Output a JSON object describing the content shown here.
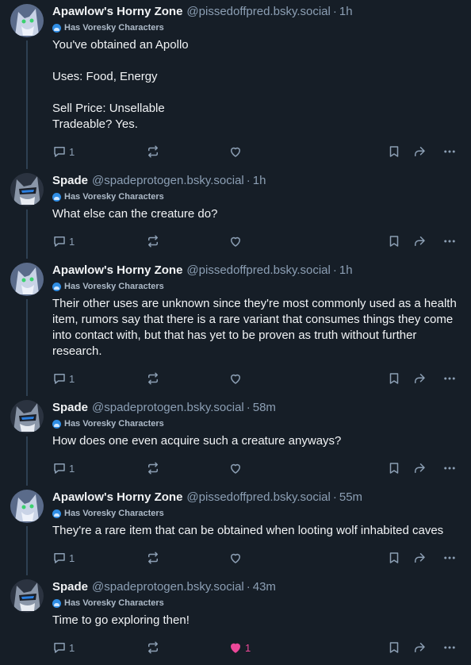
{
  "badge_label": "Has Voresky Characters",
  "posts": [
    {
      "name": "Apawlow's Horny Zone",
      "handle": "@pissedoffpred.bsky.social",
      "time": "1h",
      "text": "You've obtained an Apollo\n\nUses: Food, Energy\n\nSell Price: Unsellable\nTradeable? Yes.",
      "replies": "1",
      "likes": ""
    },
    {
      "name": "Spade",
      "handle": "@spadeprotogen.bsky.social",
      "time": "1h",
      "text": "What else can the creature do?",
      "replies": "1",
      "likes": ""
    },
    {
      "name": "Apawlow's Horny Zone",
      "handle": "@pissedoffpred.bsky.social",
      "time": "1h",
      "text": "Their other uses are unknown since they're most commonly used as a health item, rumors say that there is a rare variant that consumes things they come into contact with, but that has yet to be proven as truth without further research.",
      "replies": "1",
      "likes": ""
    },
    {
      "name": "Spade",
      "handle": "@spadeprotogen.bsky.social",
      "time": "58m",
      "text": "How does one even acquire such a creature anyways?",
      "replies": "1",
      "likes": ""
    },
    {
      "name": "Apawlow's Horny Zone",
      "handle": "@pissedoffpred.bsky.social",
      "time": "55m",
      "text": "They're a rare item that can be obtained when looting wolf inhabited caves",
      "replies": "1",
      "likes": ""
    },
    {
      "name": "Spade",
      "handle": "@spadeprotogen.bsky.social",
      "time": "43m",
      "text": "Time to go exploring then!",
      "replies": "1",
      "likes": "1"
    }
  ],
  "colors": {
    "background": "#161e27",
    "muted": "#8c9fb4",
    "like_active": "#ec4899",
    "thread_line": "#2e4052"
  }
}
